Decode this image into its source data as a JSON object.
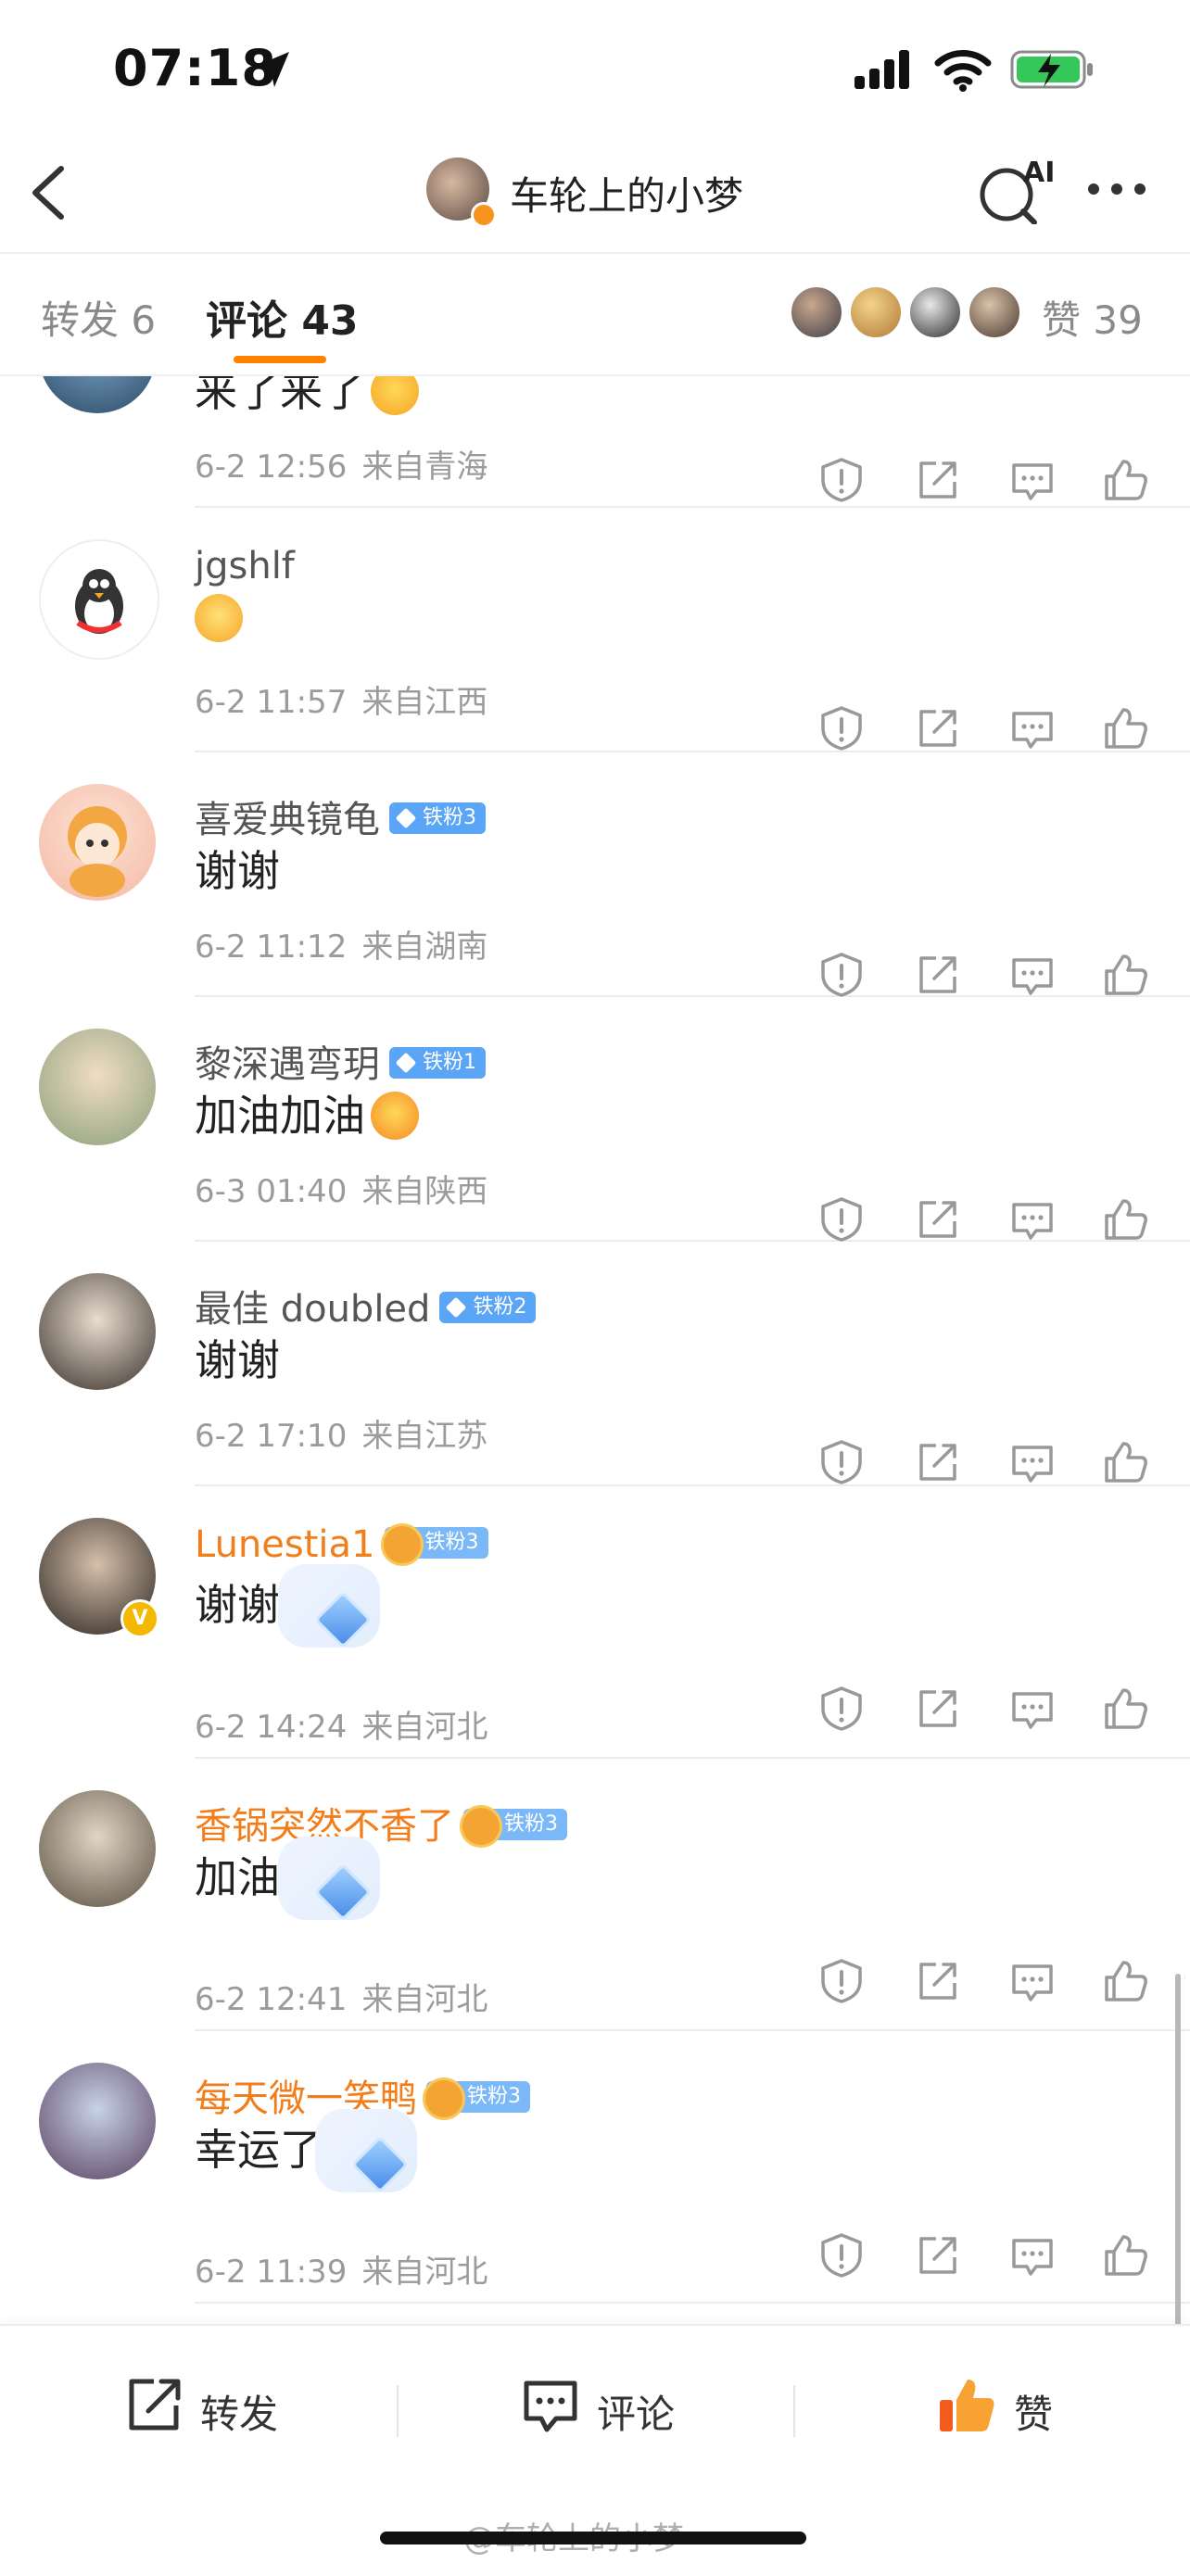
{
  "status_bar": {
    "time": "07:18"
  },
  "header": {
    "title": "车轮上的小梦",
    "ai_label": "AI"
  },
  "tabs": {
    "repost": "转发 6",
    "comment": "评论 43",
    "like": "赞 39"
  },
  "comments": [
    {
      "name": "",
      "text": "来了来了",
      "date": "6-2 12:56",
      "place": "来自青海"
    },
    {
      "name": "jgshlf",
      "text": "",
      "date": "6-2 11:57",
      "place": "来自江西"
    },
    {
      "name": "喜爱典镜龟",
      "badge": "铁粉3",
      "text": "谢谢",
      "date": "6-2 11:12",
      "place": "来自湖南"
    },
    {
      "name": "黎深遇弯玥",
      "badge": "铁粉1",
      "text": "加油加油",
      "date": "6-3 01:40",
      "place": "来自陕西"
    },
    {
      "name": "最佳 doubled",
      "badge": "铁粉2",
      "text": "谢谢",
      "date": "6-2 17:10",
      "place": "来自江苏"
    },
    {
      "name": "Lunestia1",
      "badge": "铁粉3",
      "text": "谢谢",
      "date": "6-2 14:24",
      "place": "来自河北"
    },
    {
      "name": "香锅突然不香了",
      "badge": "铁粉3",
      "text": "加油",
      "date": "6-2 12:41",
      "place": "来自河北"
    },
    {
      "name": "每天微一笑鸭",
      "badge": "铁粉3",
      "text": "幸运了",
      "date": "6-2 11:39",
      "place": "来自河北"
    }
  ],
  "bottom_bar": {
    "repost": "转发",
    "comment": "评论",
    "like": "赞"
  },
  "watermark": "@车轮上的小梦",
  "colors": {
    "accent": "#ff8200",
    "vip_name": "#f27d1b",
    "fan_badge": "#5aa5f5",
    "meta": "#9b9b9b"
  },
  "icons": [
    "location-arrow-icon",
    "signal-icon",
    "wifi-icon",
    "battery-charging-icon",
    "back-icon",
    "ai-search-icon",
    "more-icon",
    "report-icon",
    "share-icon",
    "reply-icon",
    "like-icon"
  ]
}
